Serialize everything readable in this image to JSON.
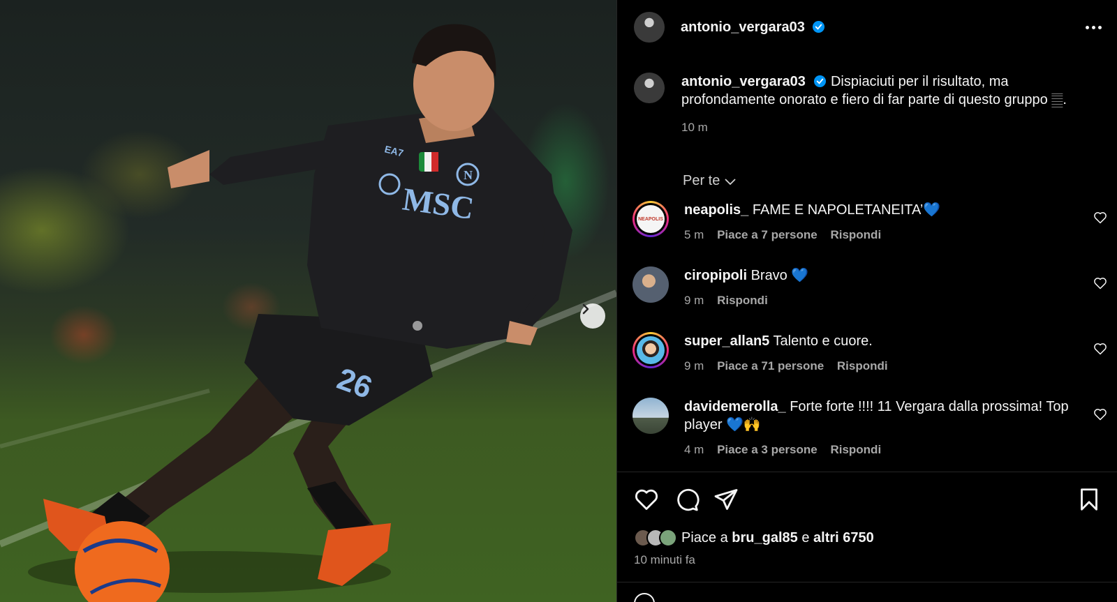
{
  "post": {
    "author": "antonio_vergara03",
    "verified": true,
    "more_icon": "more-horizontal-icon"
  },
  "caption": {
    "username": "antonio_vergara03",
    "text": "Dispiaciuti per il risultato, ma profondamente onorato e fiero di far parte di questo gruppo 𝄛.",
    "time": "10 m"
  },
  "filter": {
    "label": "Per te"
  },
  "comments": [
    {
      "username": "neapolis_",
      "text": "FAME E NAPOLETANEITA’💙",
      "time": "5 m",
      "likes": "Piace a 7 persone",
      "reply": "Rispondi",
      "avatar_text": "NEAPOLIS"
    },
    {
      "username": "ciropipoli",
      "text": "Bravo 💙",
      "time": "9 m",
      "likes": "",
      "reply": "Rispondi"
    },
    {
      "username": "super_allan5",
      "text": "Talento e cuore.",
      "time": "9 m",
      "likes": "Piace a 71 persone",
      "reply": "Rispondi"
    },
    {
      "username": "davidemerolla_",
      "text": "Forte forte !!!! 11 Vergara dalla prossima! Top player 💙🙌",
      "time": "4 m",
      "likes": "Piace a 3 persone",
      "reply": "Rispondi"
    }
  ],
  "likes": {
    "prefix": "Piace a",
    "user": "bru_gal85",
    "connector": "e",
    "others": "altri 6750"
  },
  "post_time": "10 minuti fa",
  "colors": {
    "background": "#000000",
    "text": "#f5f5f5",
    "muted": "#a8a8a8",
    "verified": "#0095f6",
    "heart_blue": "#1877f2"
  },
  "jersey": {
    "number": "26",
    "sponsor": "MSC",
    "maker": "EA7"
  }
}
